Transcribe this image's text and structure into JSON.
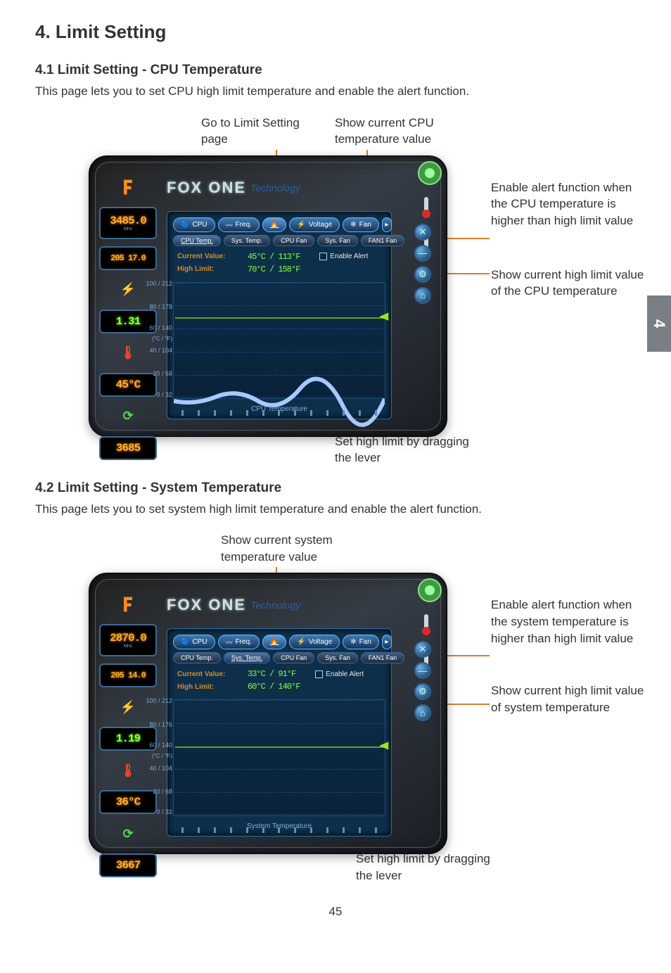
{
  "page": {
    "chapter_tab": "4",
    "footer_page": "45",
    "h1": "4. Limit Setting"
  },
  "sec1": {
    "h2": "4.1 Limit Setting - CPU Temperature",
    "p": "This page lets you to set CPU high limit temperature and enable the alert function.",
    "callouts": {
      "top_left": "Go to Limit Setting page",
      "top_right": "Show current CPU temperature value",
      "right_a": "Enable alert function when the CPU temperature is higher than high limit value",
      "right_b": "Show current high limit value of the CPU temperature",
      "bottom": "Set high limit by dragging the lever"
    },
    "skin": {
      "gauge_mhz": "3485.0",
      "gauge_mult": "205",
      "gauge_fsb": "17.0",
      "gauge_volt": "1.31",
      "gauge_temp": "45°C",
      "gauge_rpm": "3685",
      "logo": "FOX ONE",
      "swoosh": "Technology",
      "tabs": {
        "cpu": "CPU",
        "freq": "Freq.",
        "limit_icon": "limit-setting-icon",
        "voltage": "Voltage",
        "fan": "Fan"
      },
      "subtabs": {
        "cputemp": "CPU Temp.",
        "systemp": "Sys. Temp.",
        "cpufan": "CPU Fan",
        "sysfan": "Sys. Fan",
        "fan1": "FAN1 Fan"
      },
      "cur_label": "Current Value:",
      "cur_val": "45°C / 113°F",
      "hi_label": "High Limit:",
      "hi_val": "70°C / 158°F",
      "enable": "Enable Alert",
      "yticks": [
        "100 / 212",
        "80 / 178",
        "60 / 140",
        "40 / 104",
        "20 / 68",
        "0 / 32"
      ],
      "yunit": "(°C / °F)",
      "xcap": "CPU Temperature"
    }
  },
  "sec2": {
    "h2": "4.2 Limit Setting - System Temperature",
    "p": "This page lets you to set system high limit temperature and enable the alert function.",
    "callouts": {
      "top": "Show current system temperature value",
      "right_a": "Enable alert function when the system temperature is higher than high limit value",
      "right_b": "Show current high limit value of system temperature",
      "bottom": "Set high limit by dragging the lever"
    },
    "skin": {
      "gauge_mhz": "2870.0",
      "gauge_mult": "205",
      "gauge_fsb": "14.0",
      "gauge_volt": "1.19",
      "gauge_temp": "36°C",
      "gauge_rpm": "3667",
      "logo": "FOX ONE",
      "swoosh": "Technology",
      "tabs": {
        "cpu": "CPU",
        "freq": "Freq.",
        "limit_icon": "limit-setting-icon",
        "voltage": "Voltage",
        "fan": "Fan"
      },
      "subtabs": {
        "cputemp": "CPU Temp.",
        "systemp": "Sys. Temp.",
        "cpufan": "CPU Fan",
        "sysfan": "Sys. Fan",
        "fan1": "FAN1 Fan"
      },
      "cur_label": "Current Value:",
      "cur_val": "33°C / 91°F",
      "hi_label": "High Limit:",
      "hi_val": "60°C / 140°F",
      "enable": "Enable Alert",
      "yticks": [
        "100 / 212",
        "80 / 176",
        "60 / 140",
        "40 / 104",
        "20 / 68",
        "0 / 32"
      ],
      "yunit": "(°C / °F)",
      "xcap": "System Temperature"
    }
  }
}
